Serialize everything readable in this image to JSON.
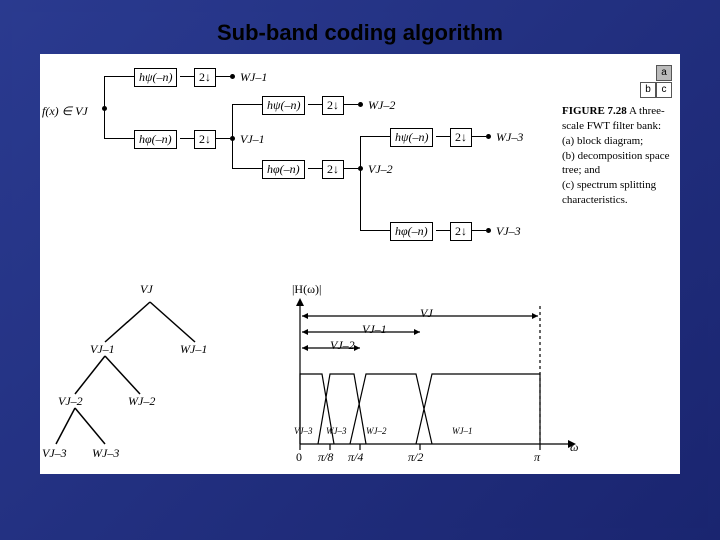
{
  "title": "Sub-band coding algorithm",
  "filter_bank": {
    "input": "f(x) ∈ VJ",
    "hpsi": "hψ(–n)",
    "hphi": "hφ(–n)",
    "down": "2↓",
    "W": [
      "WJ–1",
      "WJ–2",
      "WJ–3"
    ],
    "V": [
      "VJ–1",
      "VJ–2",
      "VJ–3"
    ]
  },
  "tree": {
    "root": "VJ",
    "nodes": [
      "VJ–1",
      "WJ–1",
      "VJ–2",
      "WJ–2",
      "VJ–3",
      "WJ–3"
    ]
  },
  "spectrum": {
    "ylabel": "|H(ω)|",
    "xlabel": "ω",
    "ticks": [
      "0",
      "π/8",
      "π/4",
      "π/2",
      "π"
    ],
    "bands": [
      "VJ–3",
      "WJ–3",
      "WJ–2",
      "WJ–1"
    ],
    "spans": [
      "VJ",
      "VJ–1",
      "VJ–2"
    ]
  },
  "figure": {
    "grid": [
      "a",
      "b",
      "c"
    ],
    "number": "FIGURE 7.28",
    "lead": "A three-scale FWT filter bank:",
    "parts": {
      "a": "(a) block diagram;",
      "b": "(b) decomposition space tree; and",
      "c": "(c) spectrum splitting characteristics."
    }
  },
  "chart_data": {
    "type": "table",
    "description": "Three-scale FWT analysis filter bank, subspace tree, and ideal band splitting.",
    "filter_bank_stages": [
      {
        "stage": 1,
        "input": "VJ",
        "highpass": "hψ(-n)→2↓→WJ-1",
        "lowpass": "hφ(-n)→2↓→VJ-1"
      },
      {
        "stage": 2,
        "input": "VJ-1",
        "highpass": "hψ(-n)→2↓→WJ-2",
        "lowpass": "hφ(-n)→2↓→VJ-2"
      },
      {
        "stage": 3,
        "input": "VJ-2",
        "highpass": "hψ(-n)→2↓→WJ-3",
        "lowpass": "hφ(-n)→2↓→VJ-3"
      }
    ],
    "subspace_tree": [
      {
        "parent": "VJ",
        "children": [
          "VJ-1",
          "WJ-1"
        ]
      },
      {
        "parent": "VJ-1",
        "children": [
          "VJ-2",
          "WJ-2"
        ]
      },
      {
        "parent": "VJ-2",
        "children": [
          "VJ-3",
          "WJ-3"
        ]
      }
    ],
    "spectrum_bands": [
      {
        "band": "VJ-3",
        "range": [
          0,
          0.3927
        ],
        "range_label": "[0, π/8]"
      },
      {
        "band": "WJ-3",
        "range": [
          0.3927,
          0.7854
        ],
        "range_label": "[π/8, π/4]"
      },
      {
        "band": "WJ-2",
        "range": [
          0.7854,
          1.5708
        ],
        "range_label": "[π/4, π/2]"
      },
      {
        "band": "WJ-1",
        "range": [
          1.5708,
          3.1416
        ],
        "range_label": "[π/2, π]"
      }
    ],
    "nested_spans": [
      {
        "space": "VJ",
        "range": [
          0,
          3.1416
        ]
      },
      {
        "space": "VJ-1",
        "range": [
          0,
          1.5708
        ]
      },
      {
        "space": "VJ-2",
        "range": [
          0,
          0.7854
        ]
      }
    ]
  }
}
